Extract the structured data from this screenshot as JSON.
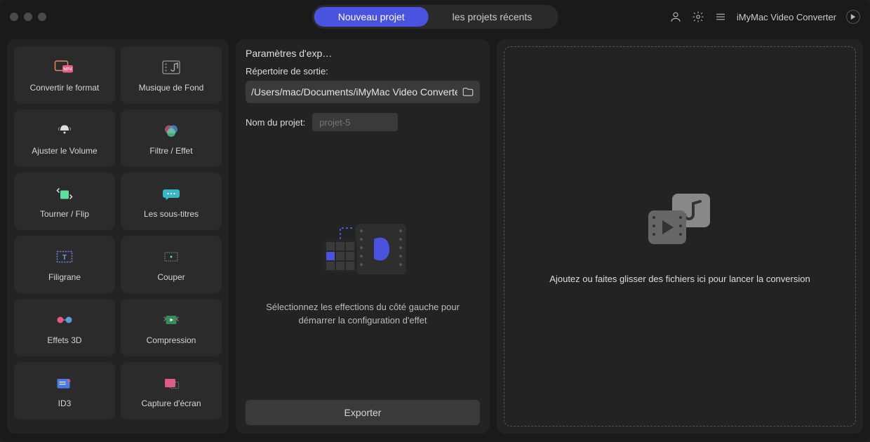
{
  "app_title": "iMyMac Video Converter",
  "top_tabs": {
    "new": "Nouveau projet",
    "recent": "les projets récents"
  },
  "sidebar": {
    "tiles": [
      {
        "id": "convert-format",
        "label": "Convertir le format"
      },
      {
        "id": "background-music",
        "label": "Musique de Fond"
      },
      {
        "id": "adjust-volume",
        "label": "Ajuster le Volume"
      },
      {
        "id": "filter-effect",
        "label": "Filtre / Effet"
      },
      {
        "id": "rotate-flip",
        "label": "Tourner / Flip"
      },
      {
        "id": "subtitles",
        "label": "Les sous-titres"
      },
      {
        "id": "watermark",
        "label": "Filigrane"
      },
      {
        "id": "cut",
        "label": "Couper"
      },
      {
        "id": "3d-effects",
        "label": "Effets 3D"
      },
      {
        "id": "compression",
        "label": "Compression"
      },
      {
        "id": "id3",
        "label": "ID3"
      },
      {
        "id": "screenshot",
        "label": "Capture d'écran"
      }
    ]
  },
  "middle": {
    "title": "Paramètres d'exp…",
    "output_dir_label": "Répertoire de sortie:",
    "output_dir_value": "/Users/mac/Documents/iMyMac Video Converte",
    "project_name_label": "Nom du projet:",
    "project_name_placeholder": "projet-5",
    "preview_text": "Sélectionnez les effections du côté gauche pour démarrer la configuration d'effet",
    "export_label": "Exporter"
  },
  "dropzone": {
    "text": "Ajoutez ou faites glisser des fichiers ici pour lancer la conversion"
  }
}
